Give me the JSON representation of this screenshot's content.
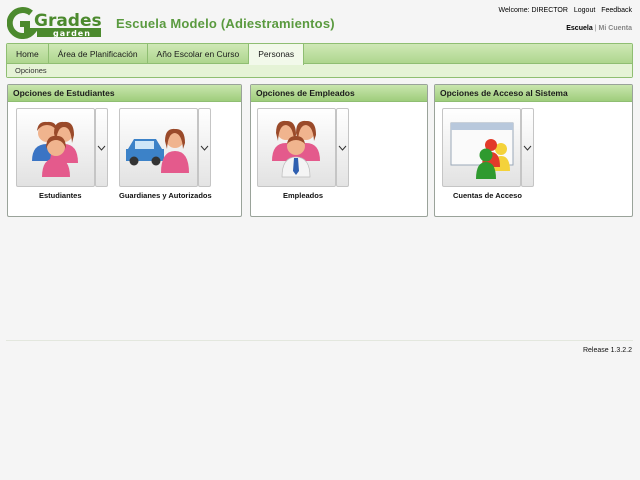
{
  "header": {
    "logo_text_top": "Grades",
    "logo_text_bottom": "garden",
    "school_title": "Escuela Modelo (Adiestramientos)",
    "welcome": "Welcome: DIRECTOR",
    "logout": "Logout",
    "feedback": "Feedback",
    "school_link": "Escuela",
    "separator": "|",
    "account_link": "Mi Cuenta"
  },
  "nav": {
    "tabs": [
      {
        "label": "Home"
      },
      {
        "label": "Área de Planificación"
      },
      {
        "label": "Año Escolar en Curso"
      },
      {
        "label": "Personas"
      }
    ],
    "subnav": "Opciones"
  },
  "panels": {
    "students": {
      "title": "Opciones de Estudiantes",
      "tiles": [
        {
          "label": "Estudiantes",
          "icon": "students-icon"
        },
        {
          "label": "Guardianes y Autorizados",
          "icon": "guardians-icon"
        }
      ]
    },
    "employees": {
      "title": "Opciones de Empleados",
      "tiles": [
        {
          "label": "Empleados",
          "icon": "employees-icon"
        }
      ]
    },
    "access": {
      "title": "Opciones de Acceso al Sistema",
      "tiles": [
        {
          "label": "Cuentas de Acceso",
          "icon": "access-accounts-icon"
        }
      ]
    }
  },
  "footer": {
    "release": "Release 1.3.2.2"
  },
  "colors": {
    "accent_green": "#5a9a3f",
    "tab_bg": "#aed68e",
    "panel_header": "#9fcd7c"
  }
}
